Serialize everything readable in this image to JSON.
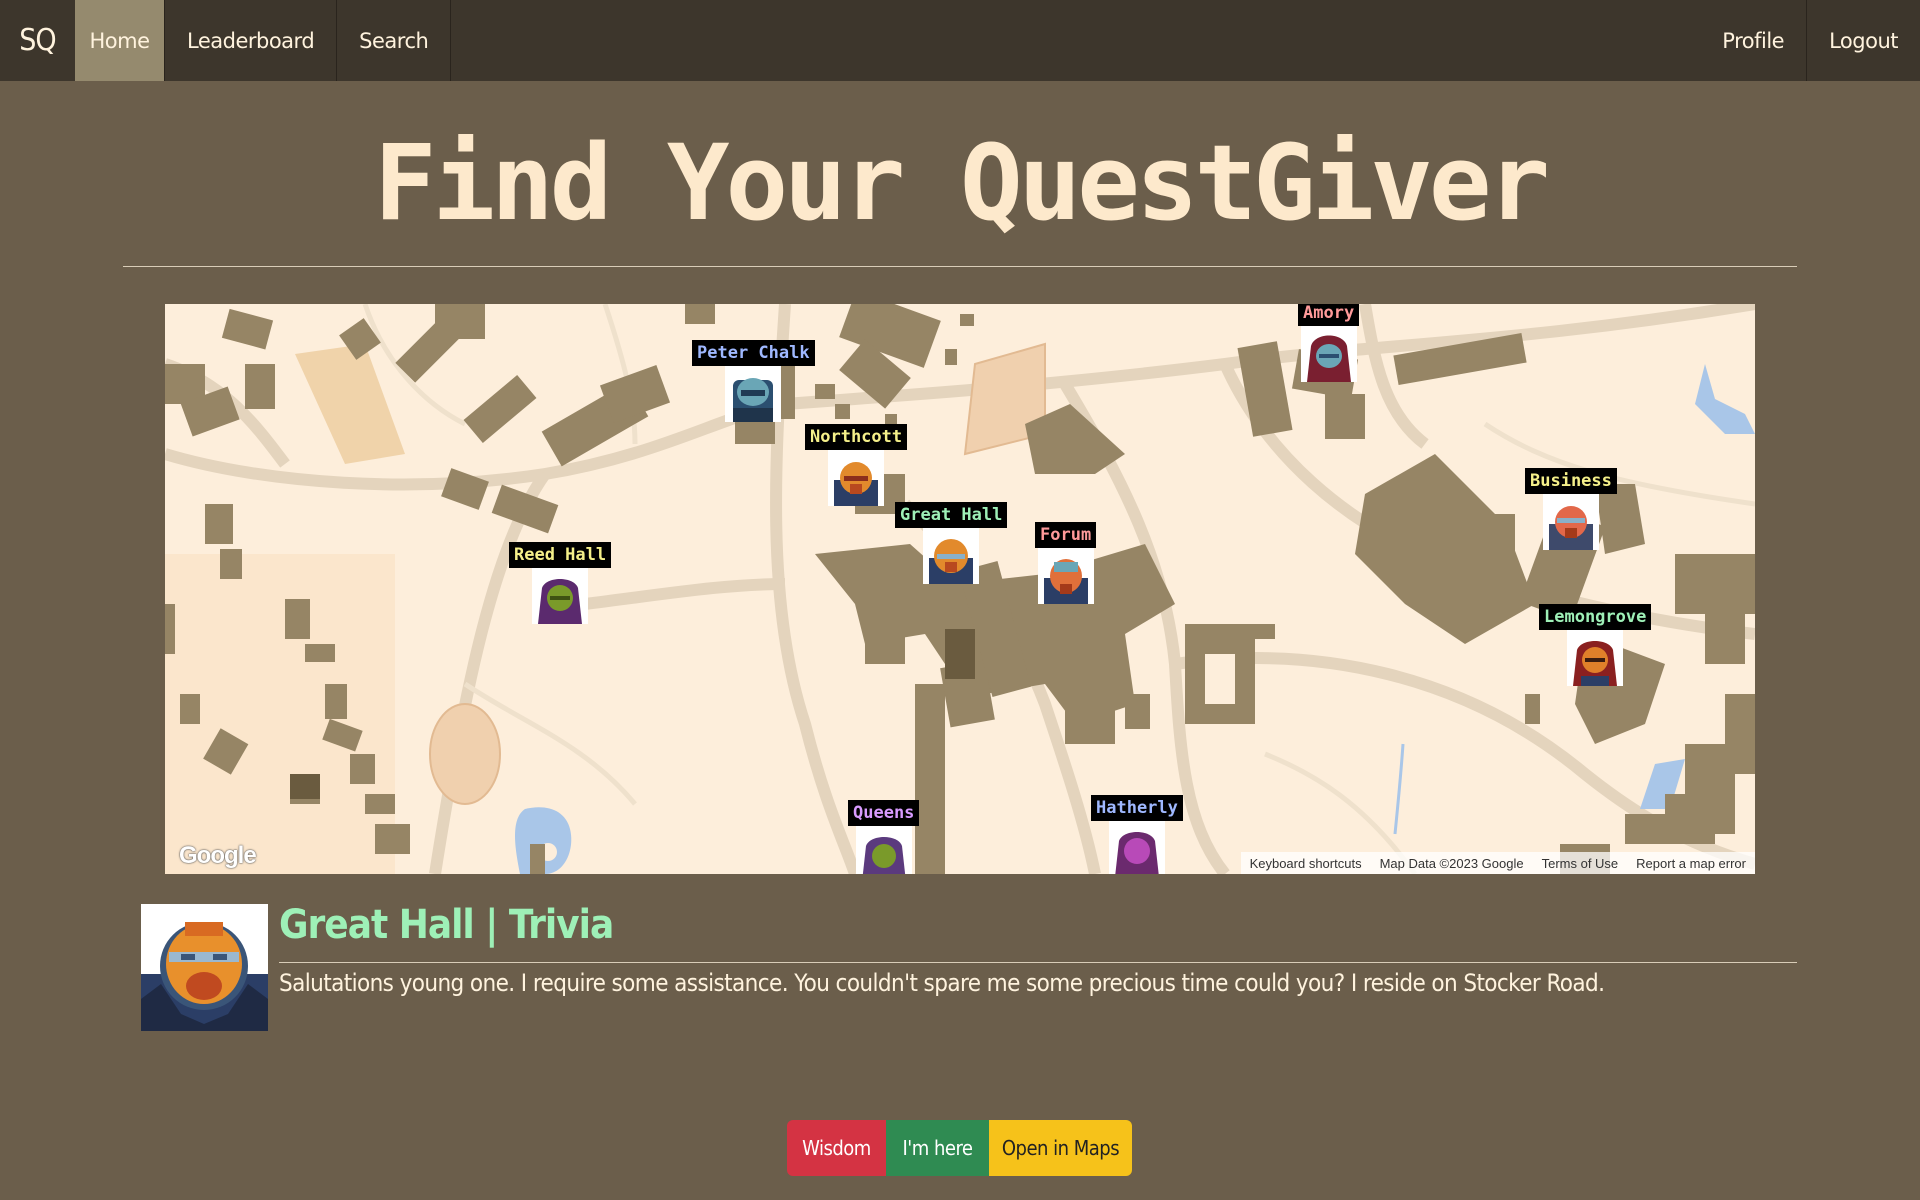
{
  "navbar": {
    "brand": "SQ",
    "items": [
      {
        "label": "Home",
        "active": true
      },
      {
        "label": "Leaderboard"
      },
      {
        "label": "Search"
      }
    ],
    "right_items": [
      {
        "label": "Profile"
      },
      {
        "label": "Logout"
      }
    ]
  },
  "page": {
    "title": "Find Your QuestGiver"
  },
  "map": {
    "markers": [
      {
        "label": "Peter Chalk",
        "color": "#9fb8ff",
        "face": "blue"
      },
      {
        "label": "Northcott",
        "color": "#f5f08a",
        "face": "orange"
      },
      {
        "label": "Great Hall",
        "color": "#9ef0b7",
        "face": "orange"
      },
      {
        "label": "Forum",
        "color": "#ff9a9a",
        "face": "orange"
      },
      {
        "label": "Reed Hall",
        "color": "#f5f08a",
        "face": "green"
      },
      {
        "label": "Amory",
        "color": "#ff9a9a",
        "face": "blue"
      },
      {
        "label": "Business",
        "color": "#f5f08a",
        "face": "orange"
      },
      {
        "label": "Lemongrove",
        "color": "#9ef0b7",
        "face": "orange"
      },
      {
        "label": "Queens",
        "color": "#d89bff",
        "face": "purple"
      },
      {
        "label": "Hatherly",
        "color": "#9fb8ff",
        "face": "purple"
      }
    ],
    "logo": "Google",
    "footer": [
      "Keyboard shortcuts",
      "Map Data ©2023 Google",
      "Terms of Use",
      "Report a map error"
    ]
  },
  "quest": {
    "title": "Great Hall | Trivia",
    "text": "Salutations young one. I require some assistance. You couldn't spare me some precious time could you? I reside on Stocker Road."
  },
  "actions": {
    "wisdom": "Wisdom",
    "here": "I'm here",
    "maps": "Open in Maps"
  },
  "colors": {
    "background": "#6b5e4b",
    "navbar": "#3d362c",
    "nav_active": "#958a6e",
    "map_land": "#fdeedb",
    "building": "#968565",
    "road": "#e4d4bd",
    "wisdom": "#d43343",
    "here": "#2f8b52",
    "maps": "#f6c21a"
  }
}
